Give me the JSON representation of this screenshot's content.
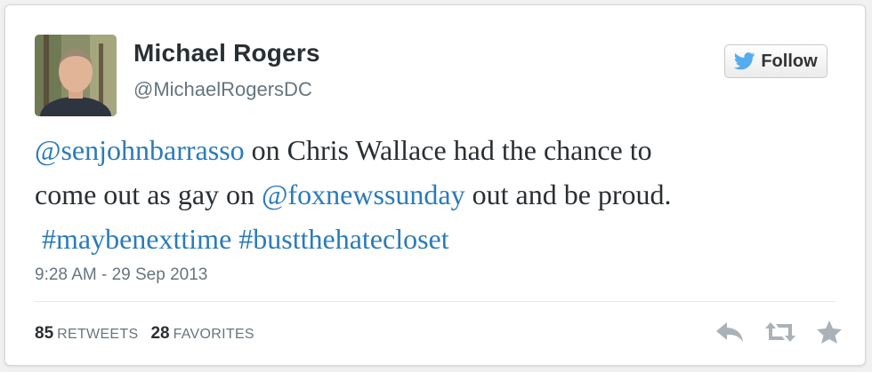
{
  "user": {
    "name": "Michael Rogers",
    "handle": "@MichaelRogersDC"
  },
  "follow": {
    "label": "Follow",
    "icon": "twitter-bird-icon"
  },
  "tweet": {
    "line1": {
      "mention": "@senjohnbarrasso",
      "text": " on Chris Wallace had the chance to"
    },
    "line2": {
      "text_before": "come out as gay on ",
      "mention": "@foxnewssunday",
      "text_after": " out and be proud."
    },
    "line3": {
      "hashtag1": "#maybenexttime",
      "hashtag2": "#bustthehatecloset"
    }
  },
  "timestamp": "9:28 AM - 29 Sep 2013",
  "stats": {
    "retweets_count": "85",
    "retweets_label": "RETWEETS",
    "favorites_count": "28",
    "favorites_label": "FAVORITES"
  },
  "actions": [
    "reply-icon",
    "retweet-icon",
    "favorite-star-icon"
  ],
  "colors": {
    "link": "#2b7bb9",
    "text": "#292f33",
    "muted": "#66757f",
    "twitter_blue": "#55acee"
  }
}
